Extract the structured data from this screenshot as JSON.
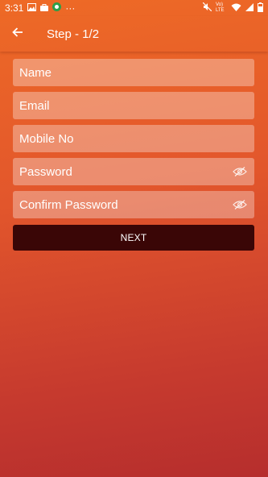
{
  "status_bar": {
    "time": "3:31",
    "notification_icons": [
      "image-icon",
      "bag-icon",
      "green-circle-icon"
    ],
    "more": "···",
    "network_label": "Vo) LTE",
    "battery": "battery-icon"
  },
  "app_bar": {
    "title": "Step - 1/2",
    "back_icon": "arrow-left-icon"
  },
  "form": {
    "name_placeholder": "Name",
    "email_placeholder": "Email",
    "mobile_placeholder": "Mobile No",
    "password_placeholder": "Password",
    "confirm_password_placeholder": "Confirm Password",
    "visibility_icon": "eye-off-icon"
  },
  "next_button": {
    "label": "NEXT",
    "color": "#3a0606"
  },
  "colors": {
    "gradient_top": "#ee6a26",
    "gradient_bottom": "#b62e2d"
  }
}
